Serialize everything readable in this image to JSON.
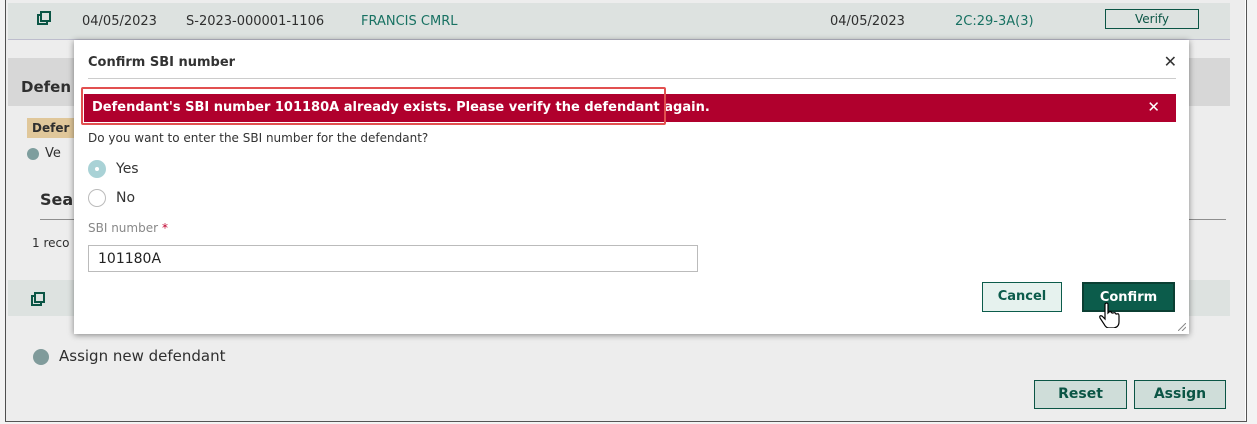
{
  "background": {
    "row1": {
      "date1": "04/05/2023",
      "case_number": "S-2023-000001-1106",
      "name": "FRANCIS CMRL",
      "date2": "04/05/2023",
      "code": "2C:29-3A(3)",
      "verify_label": "Verify"
    },
    "section_title_fragment": "Defen",
    "tag_fragment": "Defer",
    "info_fragment": "Ve",
    "search_fragment": "Sea",
    "records_fragment": "1 reco",
    "assign_new_label": "Assign new defendant",
    "reset_label": "Reset",
    "assign_label": "Assign"
  },
  "modal": {
    "title": "Confirm SBI number",
    "alert_message": "Defendant's SBI number 101180A already exists. Please verify the defendant again.",
    "question": "Do you want to enter the SBI number for the defendant?",
    "options": [
      {
        "label": "Yes",
        "selected": true
      },
      {
        "label": "No",
        "selected": false
      }
    ],
    "sbi_label": "SBI number",
    "required_marker": "*",
    "sbi_value": "101180A",
    "cancel_label": "Cancel",
    "confirm_label": "Confirm"
  },
  "colors": {
    "alert_bg": "#b0002d",
    "primary": "#0c5c4b",
    "highlight_border": "#e25050"
  }
}
